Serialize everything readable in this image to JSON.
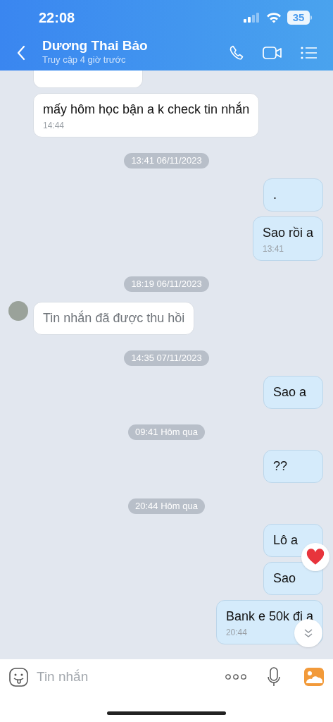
{
  "status_bar": {
    "time": "22:08",
    "battery": "35"
  },
  "header": {
    "title": "Dương Thai Bảo",
    "subtitle": "Truy cập 4 giờ trước"
  },
  "messages": [
    {
      "kind": "received",
      "clipped": true
    },
    {
      "kind": "received",
      "text": "mấy hôm học bận a k check tin nhắn",
      "time": "14:44"
    },
    {
      "kind": "divider",
      "text": "13:41 06/11/2023"
    },
    {
      "kind": "sent",
      "text": "."
    },
    {
      "kind": "sent",
      "text": "Sao rồi a",
      "time": "13:41"
    },
    {
      "kind": "divider",
      "text": "18:19 06/11/2023"
    },
    {
      "kind": "recalled",
      "text": "Tin nhắn đã được thu hồi"
    },
    {
      "kind": "divider",
      "text": "14:35 07/11/2023"
    },
    {
      "kind": "sent",
      "text": "Sao a"
    },
    {
      "kind": "divider",
      "text": "09:41 Hôm qua"
    },
    {
      "kind": "sent",
      "text": "??"
    },
    {
      "kind": "divider",
      "text": "20:44 Hôm qua"
    },
    {
      "kind": "sent",
      "text": "Lô a"
    },
    {
      "kind": "sent",
      "text": "Sao"
    },
    {
      "kind": "sent",
      "text": "Bank e 50k đi a",
      "time": "20:44"
    }
  ],
  "composer": {
    "placeholder": "Tin nhắn"
  }
}
